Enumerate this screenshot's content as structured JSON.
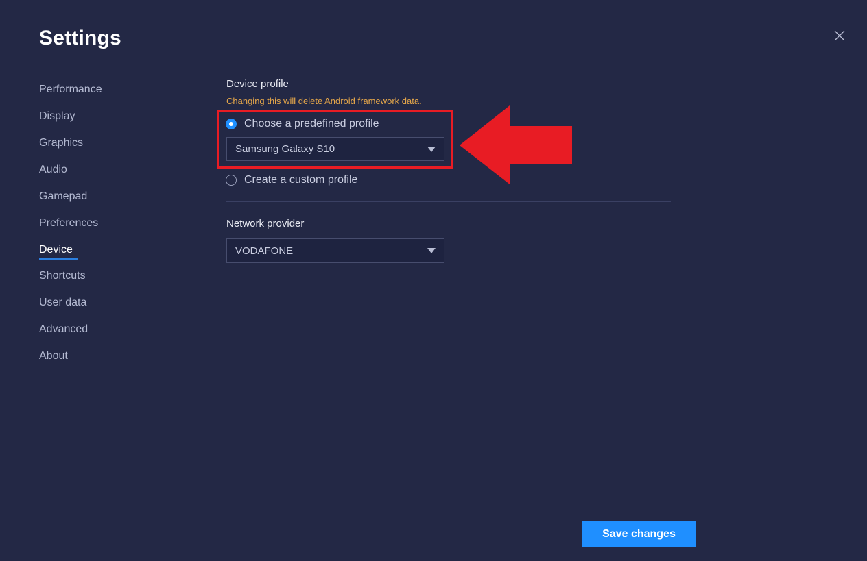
{
  "window": {
    "title": "Settings",
    "close_icon": "close-icon"
  },
  "sidebar": {
    "items": [
      {
        "label": "Performance",
        "active": false
      },
      {
        "label": "Display",
        "active": false
      },
      {
        "label": "Graphics",
        "active": false
      },
      {
        "label": "Audio",
        "active": false
      },
      {
        "label": "Gamepad",
        "active": false
      },
      {
        "label": "Preferences",
        "active": false
      },
      {
        "label": "Device",
        "active": true
      },
      {
        "label": "Shortcuts",
        "active": false
      },
      {
        "label": "User data",
        "active": false
      },
      {
        "label": "Advanced",
        "active": false
      },
      {
        "label": "About",
        "active": false
      }
    ],
    "active_index": 6
  },
  "main": {
    "device_profile": {
      "heading": "Device profile",
      "warning": "Changing this will delete Android framework data.",
      "options": [
        {
          "label": "Choose a predefined profile",
          "selected": true
        },
        {
          "label": "Create a custom profile",
          "selected": false
        }
      ],
      "profile_select": {
        "value": "Samsung Galaxy S10",
        "caret_icon": "chevron-down-icon"
      }
    },
    "network_provider": {
      "heading": "Network provider",
      "select": {
        "value": "VODAFONE",
        "caret_icon": "chevron-down-icon"
      }
    }
  },
  "footer": {
    "save_label": "Save changes"
  },
  "annotations": {
    "highlight_color": "#e81c24",
    "arrow_color": "#e81c24",
    "arrow_icon": "arrow-left-icon",
    "arrow_direction": "left"
  },
  "colors": {
    "background": "#232845",
    "accent": "#1f8fff",
    "warning": "#e4a64a",
    "text_primary": "#ffffff",
    "text_secondary": "#c9cde0",
    "annotation_red": "#e81c24"
  }
}
